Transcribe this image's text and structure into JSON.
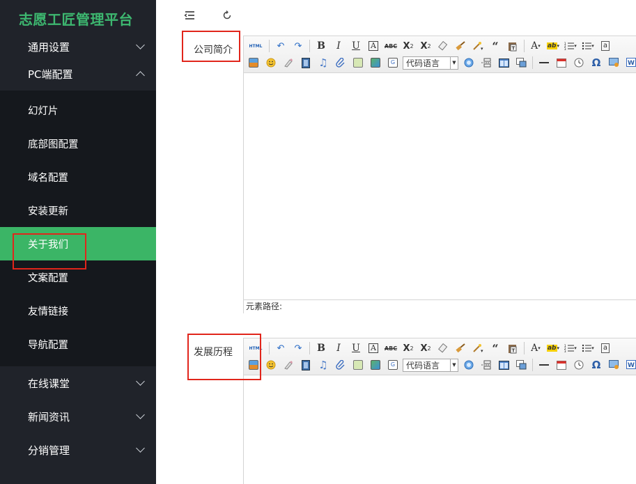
{
  "app": {
    "title": "志愿工匠管理平台",
    "accent": "#3bb566",
    "sidebar_bg": "#20232a",
    "submenu_bg": "#15181d",
    "highlight_border": "#e1251b"
  },
  "sidebar": {
    "groups": [
      {
        "label": "通用设置",
        "expanded": false
      },
      {
        "label": "PC端配置",
        "expanded": true
      },
      {
        "label": "在线课堂",
        "expanded": false
      },
      {
        "label": "新闻资讯",
        "expanded": false
      },
      {
        "label": "分销管理",
        "expanded": false
      }
    ],
    "pc_items": [
      {
        "label": "幻灯片",
        "active": false
      },
      {
        "label": "底部图配置",
        "active": false
      },
      {
        "label": "域名配置",
        "active": false
      },
      {
        "label": "安装更新",
        "active": false
      },
      {
        "label": "关于我们",
        "active": true
      },
      {
        "label": "文案配置",
        "active": false
      },
      {
        "label": "友情链接",
        "active": false
      },
      {
        "label": "导航配置",
        "active": false
      }
    ]
  },
  "header": {
    "collapse_icon": "menu-fold-icon",
    "refresh_icon": "refresh-icon"
  },
  "form": {
    "fields": [
      {
        "label": "公司简介"
      },
      {
        "label": "发展历程"
      }
    ]
  },
  "editor": {
    "html_label": "HTML",
    "code_lang_select": "代码语言",
    "status_label": "元素路径:",
    "font_color_label": "A",
    "toolbar_icons_row1": [
      "html-source-icon",
      "undo-icon",
      "redo-icon",
      "bold-icon",
      "italic-icon",
      "underline-icon",
      "font-border-icon",
      "strikethrough-icon",
      "superscript-icon",
      "subscript-icon",
      "eraser-icon",
      "format-brush-icon",
      "auto-format-icon",
      "blockquote-icon",
      "paste-text-icon",
      "font-color-icon",
      "highlight-color-icon",
      "ordered-list-icon",
      "unordered-list-icon",
      "anchor-icon"
    ],
    "toolbar_icons_row2": [
      "insert-image-icon",
      "emotion-icon",
      "scrawl-icon",
      "insert-video-icon",
      "insert-music-icon",
      "attachment-icon",
      "insert-frame-icon",
      "map-icon",
      "gmap-icon",
      "code-language-select",
      "webapp-icon",
      "page-break-icon",
      "template-icon",
      "background-icon",
      "horizontal-rule-icon",
      "date-icon",
      "time-icon",
      "special-char-icon",
      "snapscreen-icon",
      "word-image-icon"
    ]
  }
}
